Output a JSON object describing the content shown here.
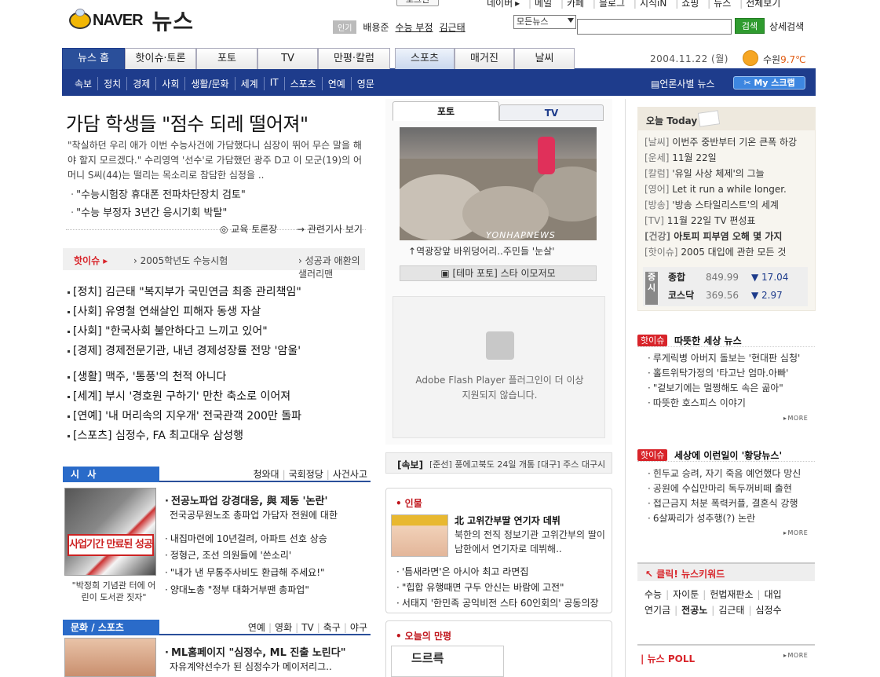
{
  "top": {
    "login_label": "로그인",
    "nav": [
      "네이버",
      "메일",
      "카페",
      "블로그",
      "지식iN",
      "쇼핑",
      "뉴스",
      "전체보기"
    ]
  },
  "logo": {
    "brand": "NAVER",
    "service": "뉴스"
  },
  "popular": {
    "tag": "인기",
    "keywords": [
      "배용준",
      "수능 부정",
      "김근태"
    ]
  },
  "search": {
    "select_value": "모든뉴스",
    "button": "검색",
    "advanced": "상세검색"
  },
  "tabs": [
    "뉴스 홈",
    "핫이슈·토론",
    "포토",
    "TV",
    "만평·칼럼",
    "스포츠",
    "매거진",
    "날씨"
  ],
  "date": "2004.11.22 (월)",
  "weather": {
    "city": "수원",
    "temp": "9.7℃"
  },
  "subnav": {
    "items": [
      "속보",
      "정치",
      "경제",
      "사회",
      "생활/문화",
      "세계",
      "IT",
      "스포츠",
      "연예",
      "영문"
    ],
    "editorial": "언론사별 뉴스",
    "myscrap": "My 스크랩"
  },
  "headline": {
    "title": "가담 학생들 \"점수 되레 떨어져\"",
    "summary": "\"착실하던 우리 애가 이번 수능사건에 가담했다니 심장이 뛰어 무슨 말을 해야 할지 모르겠다.\" 수리영역 '선수'로 가담했던 광주 D고 이 모군(19)의 어머니 S씨(44)는 떨리는 목소리로 참담한 심정을 ..",
    "bullets": [
      "\"수능시험장 휴대폰 전파차단장치 검토\"",
      "\"수능 부정자 3년간 응시기회 박탈\""
    ],
    "debate": "교육 토론장",
    "related": "관련기사 보기"
  },
  "hotissue": {
    "label": "핫이슈",
    "items": [
      "2005학년도 수능시험",
      "성공과 애환의 샐러리맨"
    ]
  },
  "stories": [
    "[정치] 김근태 \"복지부가 국민연금 최종 관리책임\"",
    "[사회] 유영철 연쇄살인 피해자 동생 자살",
    "[사회] \"한국사회 불안하다고 느끼고 있어\"",
    "[경제] 경제전문기관, 내년 경제성장률 전망 '암울'",
    "[생활] 맥주, '통풍'의 천적 아니다",
    "[세계] 부시 '경호원 구하기' 만찬 축소로 이어져",
    "[연예] '내 머리속의 지우개' 전국관객 200만 돌파",
    "[스포츠] 심정수, FA 최고대우 삼성행"
  ],
  "sisa": {
    "label": "시 사",
    "links": [
      "청와대",
      "국회정당",
      "사건사고"
    ],
    "photo_banner": "사업기간 만료된 성공동 어린이도서관 살려내라",
    "caption": "\"박정희 기념관 터에 어린이 도서관 짓자\"",
    "lead_title": "전공노파업 강경대응, 與 제동 '논란'",
    "lead_desc": "전국공무원노조 총파업 가담자 전원에 대한",
    "items": [
      "내집마련에 10년걸려, 아파트 선호 상승",
      "정형근, 조선 의원들에 '쓴소리'",
      "\"내가 낸 무통주사비도 환급해 주세요!\"",
      "양대노총 \"정부 대화거부땐 총파업\""
    ]
  },
  "culture": {
    "label": "문화 / 스포츠",
    "links": [
      "연예",
      "영화",
      "TV",
      "축구",
      "야구"
    ],
    "lead_title": "ML홈페이지 \"심정수, ML 진출 노린다\"",
    "lead_desc": "자유계약선수가 된 심정수가 메이저리그.."
  },
  "media": {
    "tab_photo": "포토",
    "tab_tv": "TV",
    "watermark": "YONHAPNEWS",
    "photo_caption": "역광장앞 바위덩어리..주민들 '눈살'",
    "theme": "[테마 포토] 스타 이모저모",
    "flash_msg_1": "Adobe Flash Player 플러그인이 더 이상",
    "flash_msg_2": "지원되지 않습니다."
  },
  "breaking": {
    "label": "[속보]",
    "text": "[준선] 풍에고북도 24일 개통 [대구] 주스 대구시 성 개발 사업 세"
  },
  "person": {
    "label": "인물",
    "title": "北 고위간부딸 연기자 데뷔",
    "desc": "북한의 전직 정보기관 고위간부의 딸이 남한에서 연기자로 데뷔해..",
    "items": [
      "'틈새라면'은 아시아 최고 라면집",
      "\"힙합 유행때면 구두 안신는 바람에 고전\"",
      "서태지 '한민족 공익비전 스타 60인회의' 공동의장"
    ]
  },
  "cartoon": {
    "label": "오늘의 만평",
    "image_text": "드르륵"
  },
  "today": {
    "title": "오늘 Today",
    "rows": [
      {
        "cat": "[날씨]",
        "text": "이번주 중반부터 기온 큰폭 하강"
      },
      {
        "cat": "[운세]",
        "text": "11월 22일"
      },
      {
        "cat": "[칼럼]",
        "text": "'유일 사상 체제'의 그늘"
      },
      {
        "cat": "[영어]",
        "text": "Let it run a while longer."
      },
      {
        "cat": "[방송]",
        "text": "'방송 스타일리스트'의 세계"
      },
      {
        "cat": "[TV]",
        "text": "11월 22일 TV 편성표"
      },
      {
        "cat": "[건강]",
        "text": "아토피 피부염 오해 몇 가지"
      },
      {
        "cat": "[핫이슈]",
        "text": "2005 대입에 관한 모든 것"
      }
    ],
    "stock_side": "증시",
    "stocks": [
      {
        "name": "종합",
        "value": "849.99",
        "change": "▼ 17.04"
      },
      {
        "name": "코스닥",
        "value": "369.56",
        "change": "▼ 2.97"
      }
    ]
  },
  "warm": {
    "tag": "핫이슈",
    "title": "따뜻한 세상 뉴스",
    "items": [
      "루게릭병 아버지 돌보는 '현대판 심청'",
      "홀트위탁가정의 '타고난 엄마.아빠'",
      "\"겉보기에는 멀쩡해도 속은 곪아\"",
      "따뜻한 호스피스 이야기"
    ]
  },
  "strange": {
    "tag": "핫이슈",
    "title": "세상에 이런일이 '황당뉴스'",
    "items": [
      "힌두교 승려, 자기 죽음 예언했다 망신",
      "공원에 수십만마리 독두꺼비떼 출현",
      "접근금지 처분 폭력커플, 결혼식 강행",
      "6살짜리가 성추행(?) 논란"
    ]
  },
  "more": "MORE",
  "keywords": {
    "title": "클릭! 뉴스키워드",
    "row1": [
      "수능",
      "자이툰",
      "헌법재판소",
      "대입"
    ],
    "row2": [
      "연기금",
      "전공노",
      "김근태",
      "심정수"
    ]
  },
  "poll": {
    "title": "뉴스 POLL"
  },
  "colors": {
    "brand_blue": "#1e3c8c",
    "accent_red": "#d8242a",
    "search_green": "#2f9b2f"
  }
}
